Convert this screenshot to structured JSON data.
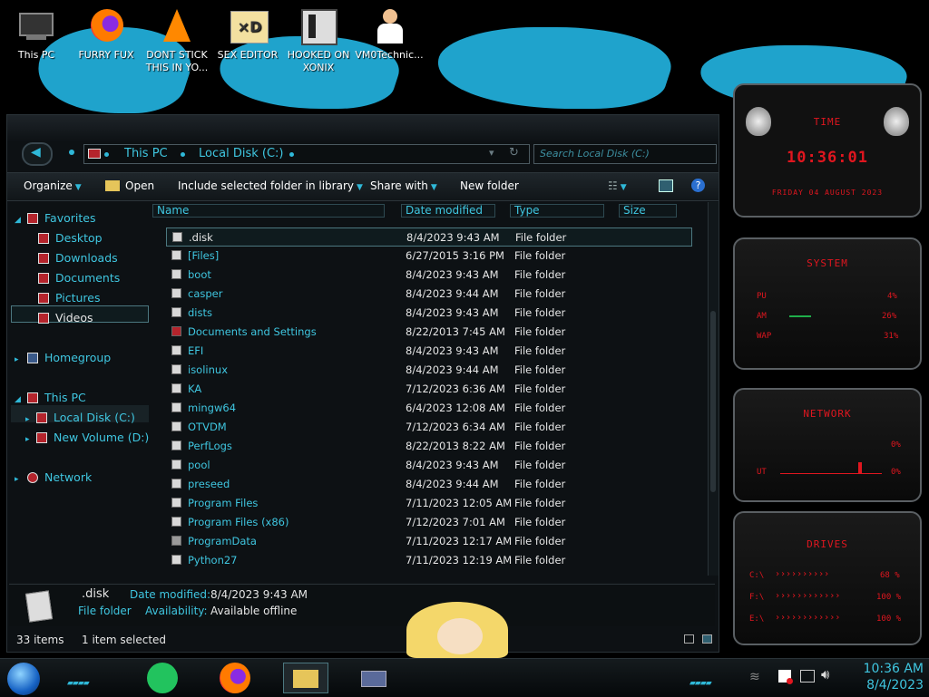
{
  "desktop": {
    "icons": [
      {
        "label": "This PC",
        "icon": "computer-icon"
      },
      {
        "label": "FURRY FUX",
        "icon": "firefox-icon"
      },
      {
        "label": "DONT STICK THIS IN YO...",
        "icon": "vlc-icon"
      },
      {
        "label": "SEX EDITOR",
        "icon": "hex-editor-icon"
      },
      {
        "label": "HOOKED ON XONIX",
        "icon": "xonix-icon"
      },
      {
        "label": "VM0Technic...",
        "icon": "doctor-icon"
      }
    ]
  },
  "address": {
    "segments": [
      "This PC",
      "Local Disk (C:)"
    ],
    "search_placeholder": "Search Local Disk (C:)"
  },
  "toolbar": {
    "organize": "Organize",
    "open": "Open",
    "include": "Include selected folder in library",
    "share": "Share with",
    "new_folder": "New folder"
  },
  "nav": {
    "favorites": "Favorites",
    "desktop": "Desktop",
    "downloads": "Downloads",
    "documents": "Documents",
    "pictures": "Pictures",
    "videos": "Videos",
    "homegroup": "Homegroup",
    "this_pc": "This PC",
    "local_disk": "Local Disk (C:)",
    "new_volume": "New Volume (D:)",
    "network": "Network"
  },
  "columns": {
    "name": "Name",
    "date": "Date modified",
    "type": "Type",
    "size": "Size"
  },
  "files": [
    {
      "name": ".disk",
      "date": "8/4/2023 9:43 AM",
      "type": "File folder"
    },
    {
      "name": "[Files]",
      "date": "6/27/2015 3:16 PM",
      "type": "File folder"
    },
    {
      "name": "boot",
      "date": "8/4/2023 9:43 AM",
      "type": "File folder"
    },
    {
      "name": "casper",
      "date": "8/4/2023 9:44 AM",
      "type": "File folder"
    },
    {
      "name": "dists",
      "date": "8/4/2023 9:43 AM",
      "type": "File folder"
    },
    {
      "name": "Documents and Settings",
      "date": "8/22/2013 7:45 AM",
      "type": "File folder"
    },
    {
      "name": "EFI",
      "date": "8/4/2023 9:43 AM",
      "type": "File folder"
    },
    {
      "name": "isolinux",
      "date": "8/4/2023 9:44 AM",
      "type": "File folder"
    },
    {
      "name": "KA",
      "date": "7/12/2023 6:36 AM",
      "type": "File folder"
    },
    {
      "name": "mingw64",
      "date": "6/4/2023 12:08 AM",
      "type": "File folder"
    },
    {
      "name": "OTVDM",
      "date": "7/12/2023 6:34 AM",
      "type": "File folder"
    },
    {
      "name": "PerfLogs",
      "date": "8/22/2013 8:22 AM",
      "type": "File folder"
    },
    {
      "name": "pool",
      "date": "8/4/2023 9:43 AM",
      "type": "File folder"
    },
    {
      "name": "preseed",
      "date": "8/4/2023 9:44 AM",
      "type": "File folder"
    },
    {
      "name": "Program Files",
      "date": "7/11/2023 12:05 AM",
      "type": "File folder"
    },
    {
      "name": "Program Files (x86)",
      "date": "7/12/2023 7:01 AM",
      "type": "File folder"
    },
    {
      "name": "ProgramData",
      "date": "7/11/2023 12:17 AM",
      "type": "File folder"
    },
    {
      "name": "Python27",
      "date": "7/11/2023 12:19 AM",
      "type": "File folder"
    }
  ],
  "details": {
    "name": ".disk",
    "kind": "File folder",
    "date_label": "Date modified:",
    "date_value": "8/4/2023 9:43 AM",
    "avail_label": "Availability:",
    "avail_value": "Available offline"
  },
  "status": {
    "count": "33 items",
    "selected": "1 item selected"
  },
  "gadget": {
    "time_title": "TIME",
    "time_value": "10:36:01",
    "date_value": "FRIDAY 04 AUGUST 2023",
    "system_title": "SYSTEM",
    "cpu_label": "PU",
    "cpu_value": "4%",
    "ram_label": "AM",
    "ram_value": "26%",
    "swap_label": "WAP",
    "swap_value": "31%",
    "network_title": "NETWORK",
    "net_in_value": "0%",
    "net_out_label": "UT",
    "net_out_value": "0%",
    "drives_title": "DRIVES",
    "drive_c_label": "C:\\",
    "drive_c_value": "68 %",
    "drive_f_label": "F:\\",
    "drive_f_value": "100 %",
    "drive_e_label": "E:\\",
    "drive_e_value": "100 %"
  },
  "taskbar": {
    "time": "10:36 AM",
    "date": "8/4/2023"
  },
  "colors": {
    "accent": "#3fc6e0",
    "alert": "#e0161f",
    "window_bg": "#0d1114"
  }
}
